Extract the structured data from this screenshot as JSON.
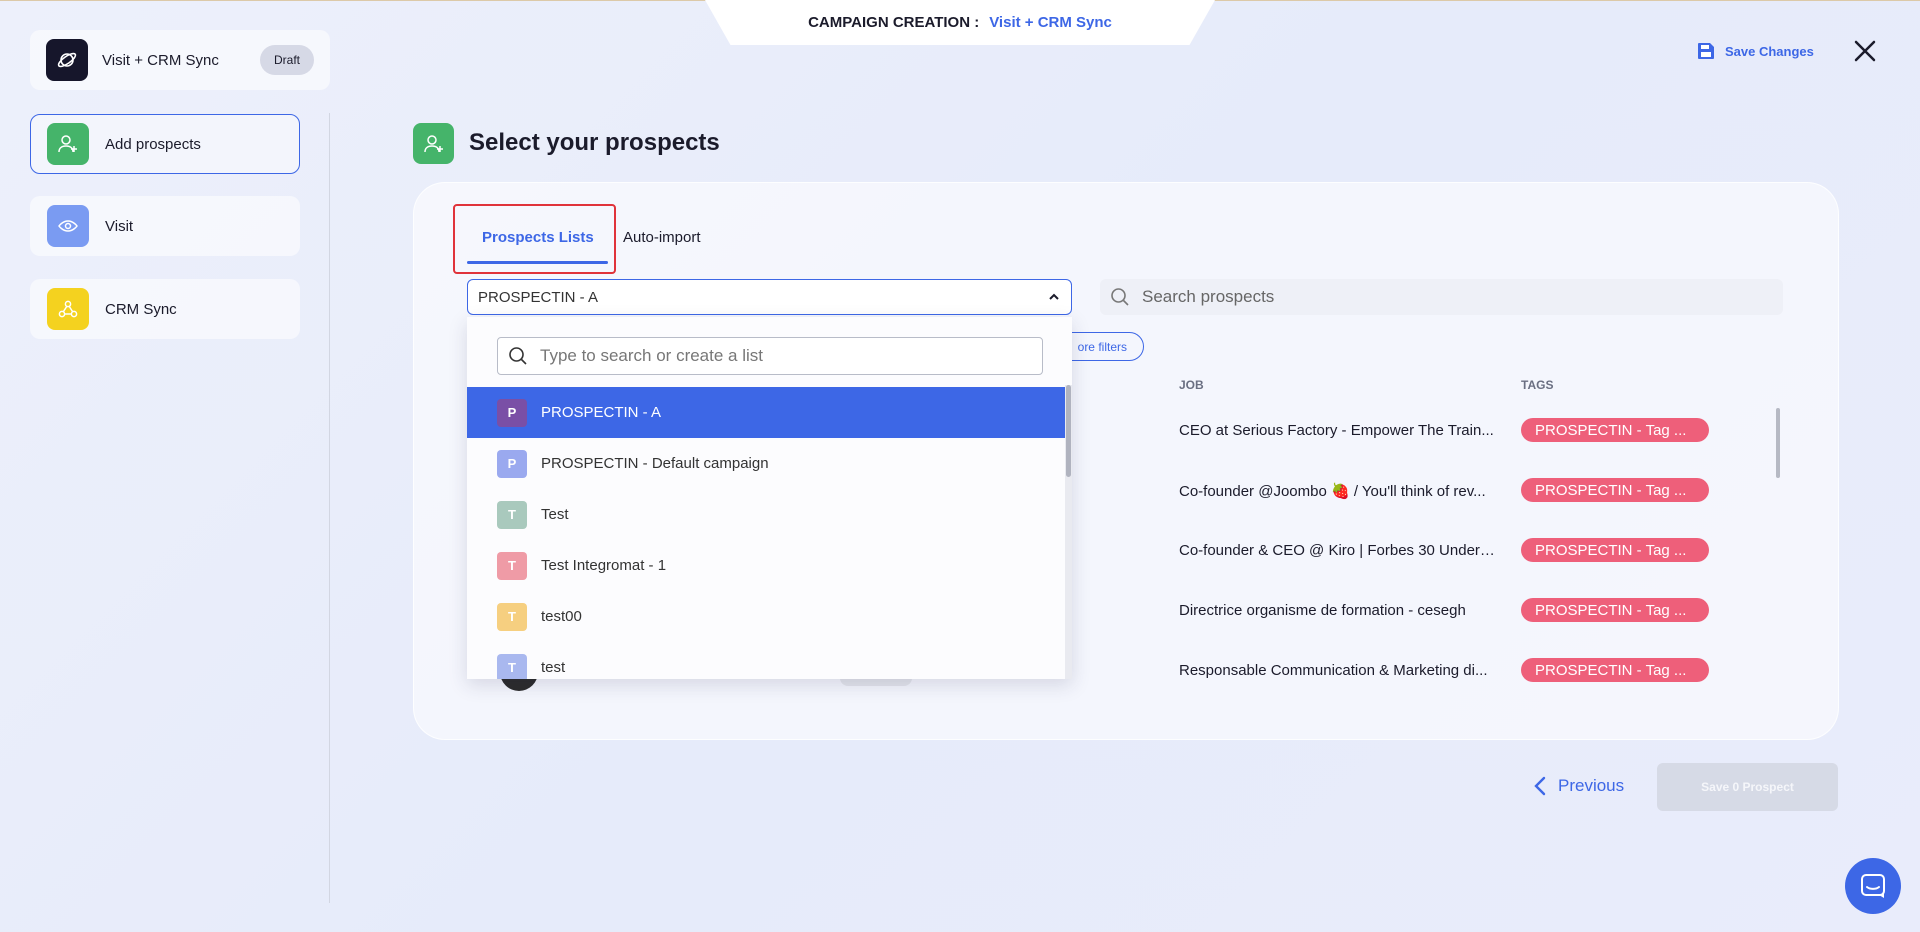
{
  "header": {
    "label": "CAMPAIGN CREATION :",
    "campaign_name": "Visit + CRM Sync",
    "save_changes": "Save Changes"
  },
  "campaign": {
    "title": "Visit + CRM Sync",
    "status": "Draft"
  },
  "steps": [
    {
      "label": "Add prospects",
      "icon": "user-plus-icon",
      "color": "#45b46a"
    },
    {
      "label": "Visit",
      "icon": "eye-icon",
      "color": "#7a9bf2"
    },
    {
      "label": "CRM Sync",
      "icon": "webhook-icon",
      "color": "#f4d21f"
    }
  ],
  "section": {
    "title": "Select your prospects"
  },
  "tabs": [
    {
      "label": "Prospects Lists",
      "active": true
    },
    {
      "label": "Auto-import",
      "active": false
    }
  ],
  "list_select": {
    "value": "PROSPECTIN - A"
  },
  "search": {
    "placeholder": "Search prospects"
  },
  "filters": {
    "more_label": "ore filters"
  },
  "table": {
    "headers": {
      "job": "JOB",
      "tags": "TAGS"
    },
    "rows": [
      {
        "job": "CEO at Serious Factory - Empower The Train...",
        "tag": "PROSPECTIN - Tag ..."
      },
      {
        "job": "Co-founder @Joombo 🍓 / You'll think of rev...",
        "tag": "PROSPECTIN - Tag ..."
      },
      {
        "job": "Co-founder & CEO @ Kiro | Forbes 30 Under 30",
        "tag": "PROSPECTIN - Tag ..."
      },
      {
        "job": "Directrice organisme de formation - cesegh",
        "tag": "PROSPECTIN - Tag ..."
      },
      {
        "job": "Responsable Communication & Marketing di...",
        "tag": "PROSPECTIN - Tag ..."
      }
    ]
  },
  "dropdown": {
    "placeholder": "Type to search or create a list",
    "items": [
      {
        "letter": "P",
        "name": "PROSPECTIN - A",
        "color": "#7a4fa6",
        "selected": true
      },
      {
        "letter": "P",
        "name": "PROSPECTIN - Default campaign",
        "color": "#9aa9ef",
        "selected": false
      },
      {
        "letter": "T",
        "name": "Test",
        "color": "#a9c9bd",
        "selected": false
      },
      {
        "letter": "T",
        "name": "Test Integromat - 1",
        "color": "#ef9ba6",
        "selected": false
      },
      {
        "letter": "T",
        "name": "test00",
        "color": "#f6cf80",
        "selected": false
      },
      {
        "letter": "T",
        "name": "test",
        "color": "#a9b8ef",
        "selected": false
      }
    ]
  },
  "footer": {
    "previous": "Previous",
    "save": "Save 0 Prospect"
  }
}
